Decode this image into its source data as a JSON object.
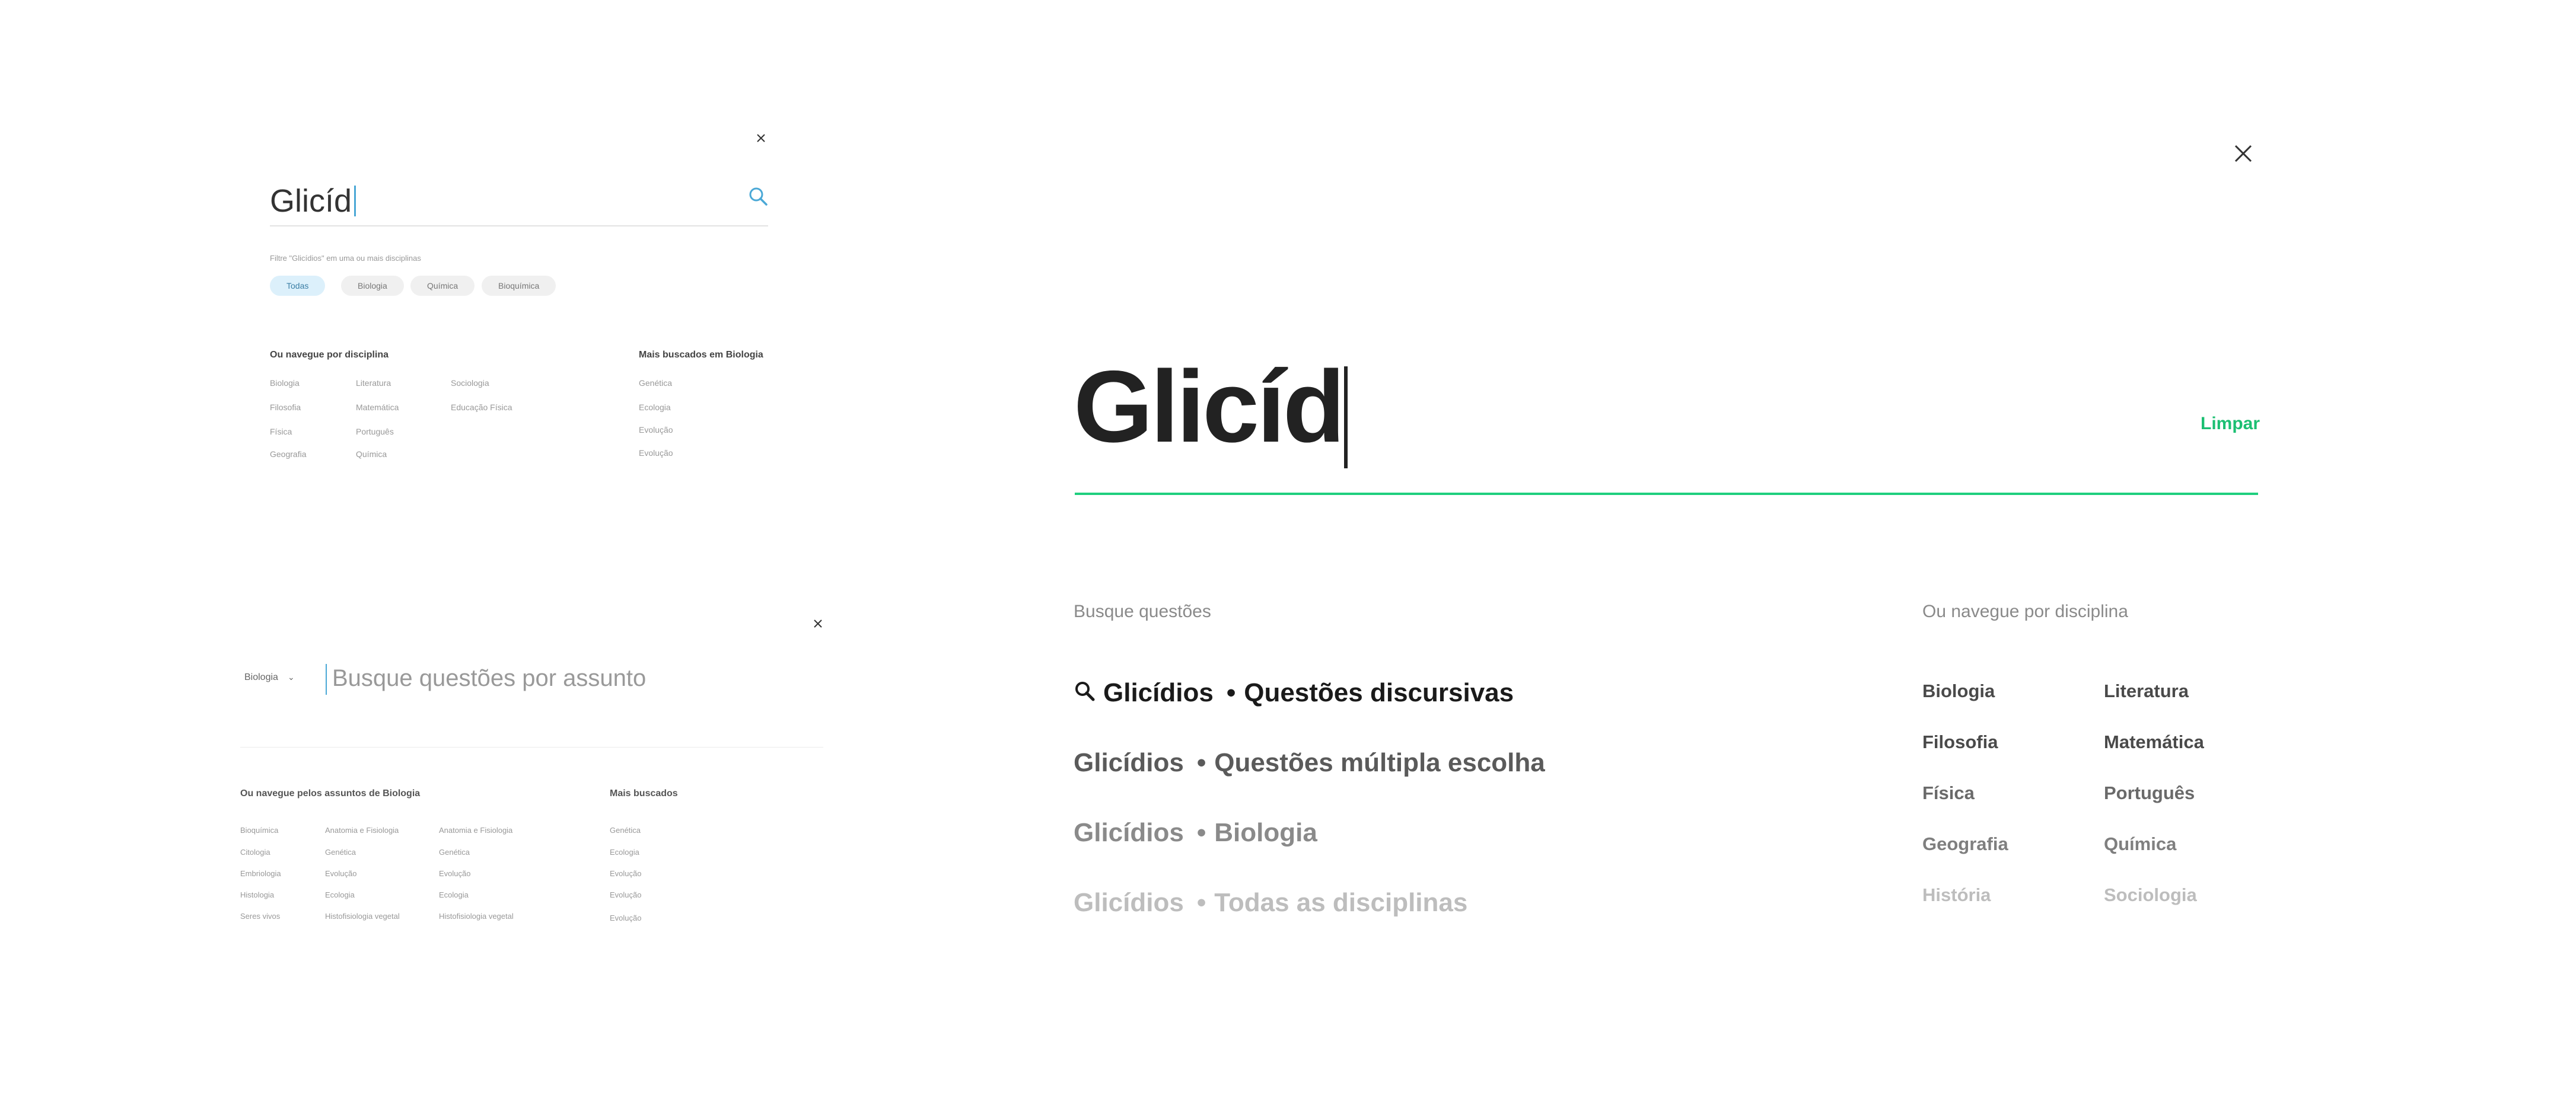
{
  "panel_a": {
    "query": "Glicíd",
    "filter_hint": "Filtre \"Glicídios\" em uma ou mais disciplinas",
    "chips": [
      {
        "label": "Todas",
        "active": true
      },
      {
        "label": "Biologia",
        "active": false
      },
      {
        "label": "Química",
        "active": false
      },
      {
        "label": "Bioquímica",
        "active": false
      }
    ],
    "browse_heading": "Ou navegue por disciplina",
    "disciplines_col1": [
      "Biologia",
      "Filosofia",
      "Física",
      "Geografia"
    ],
    "disciplines_col2": [
      "Literatura",
      "Matemática",
      "Português",
      "Química"
    ],
    "disciplines_col3": [
      "Sociologia",
      "Educação Física"
    ],
    "popular_heading": "Mais buscados em Biologia",
    "popular": [
      "Genética",
      "Ecologia",
      "Evolução",
      "Evolução"
    ]
  },
  "panel_b": {
    "subject_select": "Biologia",
    "search_placeholder": "Busque questões por assunto",
    "browse_heading": "Ou navegue pelos assuntos de Biologia",
    "col1": [
      "Bioquímica",
      "Citologia",
      "Embriologia",
      "Histologia",
      "Seres vivos"
    ],
    "col2": [
      "Anatomia e Fisiologia",
      "Genética",
      "Evolução",
      "Ecologia",
      "Histofisiologia vegetal"
    ],
    "col3": [
      "Anatomia e Fisiologia",
      "Genética",
      "Evolução",
      "Ecologia",
      "Histofisiologia vegetal"
    ],
    "popular_heading": "Mais buscados",
    "popular": [
      "Genética",
      "Ecologia",
      "Evolução",
      "Evolução",
      "Evolução"
    ]
  },
  "panel_c": {
    "query": "Glicíd",
    "clear_label": "Limpar",
    "search_section_label": "Busque questões",
    "suggestions": [
      {
        "term": "Glicídios",
        "context": "Questões discursivas",
        "color": "#1a1a1a",
        "icon": "search-icon"
      },
      {
        "term": "Glicídios",
        "context": "Questões múltipla escolha",
        "color": "#5a5a5a"
      },
      {
        "term": "Glicídios",
        "context": "Biologia",
        "color": "#8a8a8a"
      },
      {
        "term": "Glicídios",
        "context": "Todas as disciplinas",
        "color": "#b8b8b8"
      }
    ],
    "disciplines_label": "Ou navegue por disciplina",
    "disciplines_col1": [
      "Biologia",
      "Filosofia",
      "Física",
      "Geografia",
      "História"
    ],
    "disciplines_col2": [
      "Literatura",
      "Matemática",
      "Português",
      "Química",
      "Sociologia"
    ],
    "discipline_row_colors": [
      "#4a4a4a",
      "#4a4a4a",
      "#6a6a6a",
      "#7f7f7f",
      "#bdbdbd"
    ]
  },
  "colors": {
    "accent_green": "#1fcf7e",
    "accent_blue": "#4aa8d6",
    "chip_active_bg": "#dcf0fb"
  }
}
